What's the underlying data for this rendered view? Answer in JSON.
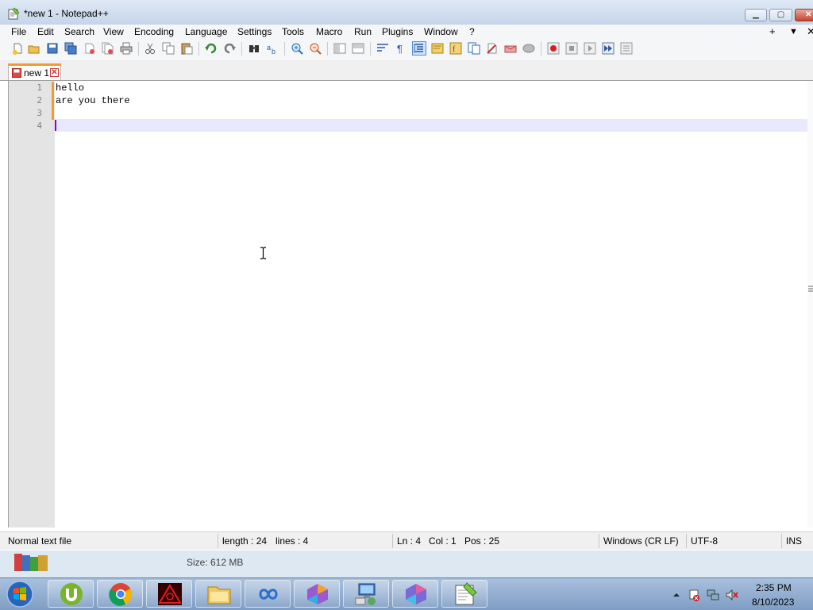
{
  "window": {
    "title": "*new 1 - Notepad++",
    "minimize_icon": "minimize-icon",
    "maximize_icon": "maximize-icon",
    "close_icon": "close-icon"
  },
  "menu": {
    "items": [
      "File",
      "Edit",
      "Search",
      "View",
      "Encoding",
      "Language",
      "Settings",
      "Tools",
      "Macro",
      "Run",
      "Plugins",
      "Window",
      "?"
    ],
    "right": [
      "+",
      "▼",
      "✕"
    ]
  },
  "toolbar": {
    "icons": [
      "new-file-icon",
      "open-file-icon",
      "save-icon",
      "save-all-icon",
      "close-icon",
      "close-all-icon",
      "print-icon",
      "cut-icon",
      "copy-icon",
      "paste-icon",
      "undo-icon",
      "redo-icon",
      "find-icon",
      "replace-icon",
      "zoom-in-icon",
      "zoom-out-icon",
      "sync-vertical-icon",
      "sync-horizontal-icon",
      "word-wrap-icon",
      "show-all-chars-icon",
      "indent-guide-icon",
      "doc-map-icon",
      "function-list-icon",
      "folder-workspace-icon",
      "monitoring-icon",
      "doc-list-icon",
      "comment-icon",
      "record-macro-icon",
      "stop-macro-icon",
      "play-macro-icon",
      "run-multiple-macro-icon",
      "save-macro-icon"
    ]
  },
  "tabs": [
    {
      "label": "new 1",
      "icon": "unsaved-file-icon",
      "close": "✕"
    }
  ],
  "editor": {
    "line_numbers": [
      "1",
      "2",
      "3",
      "4"
    ],
    "lines": [
      "hello",
      "are you there",
      "",
      ""
    ],
    "current_line": 4
  },
  "status": {
    "file_type": "Normal text file",
    "length": "length : 24",
    "lines": "lines : 4",
    "ln": "Ln : 4",
    "col": "Col : 1",
    "pos": "Pos : 25",
    "eol": "Windows (CR LF)",
    "encoding": "UTF-8",
    "mode": "INS"
  },
  "underlying": {
    "size_text": "Size: 612 MB"
  },
  "taskbar": {
    "apps": [
      "utorrent-icon",
      "chrome-icon",
      "vpn-icon",
      "file-explorer-icon",
      "infinity-icon",
      "app-icon",
      "network-icon",
      "app-icon-2",
      "notepad-plus-plus-icon"
    ],
    "clock_time": "2:35 PM",
    "clock_date": "8/10/2023"
  },
  "colors": {
    "accent_orange": "#f29b32",
    "caret": "#8000ff",
    "current_line_bg": "#e8e8ff"
  }
}
